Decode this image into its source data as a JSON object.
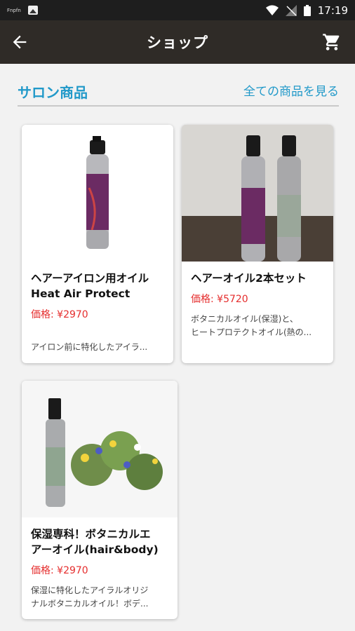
{
  "status_bar": {
    "notification_text": "Fnpfn",
    "time": "17:19"
  },
  "app_bar": {
    "title": "ショップ"
  },
  "section": {
    "title": "サロン商品",
    "see_all": "全ての商品を見る"
  },
  "products": [
    {
      "name": "ヘアーアイロン用オイル",
      "name_sub": "Heat Air Protect",
      "price": "価格: ¥2970",
      "desc": "アイロン前に特化したアイラ..."
    },
    {
      "name": "ヘアーオイル2本セット",
      "price": "価格: ¥5720",
      "desc_1": "ボタニカルオイル(保湿)と、",
      "desc_2": "ヒートプロテクトオイル(熱の..."
    },
    {
      "name_1": "保湿専科！ボタニカルエ",
      "name_2": "アーオイル(hair&body)",
      "price": "価格: ¥2970",
      "desc_1": "保湿に特化したアイラルオリジ",
      "desc_2": "ナルボタニカルオイル！ボデ..."
    }
  ],
  "colors": {
    "accent": "#2199c9",
    "price": "#e52d2d",
    "app_bar": "#2f2b27"
  }
}
